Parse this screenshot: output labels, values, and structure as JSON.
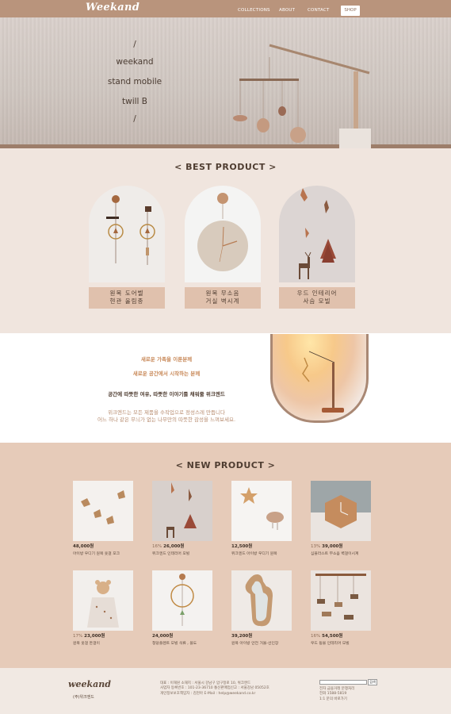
{
  "nav": {
    "logo": "Weekand",
    "menu": [
      "COLLECTIONS",
      "ABOUT",
      "CONTACT"
    ],
    "shop": "SHOP"
  },
  "hero": {
    "lines": [
      "/",
      "weekand",
      "stand mobile",
      "twill B",
      "/"
    ]
  },
  "best": {
    "title": "< BEST PRODUCT >",
    "cards": [
      {
        "line1": "원목 도어벨",
        "line2": "현관 울림종"
      },
      {
        "line1": "원목 무소음",
        "line2": "거실 벽시계"
      },
      {
        "line1": "우드 인테리어",
        "line2": "사슴 모빌"
      }
    ]
  },
  "story": {
    "line1": "새로운 가족을 이룬분께",
    "line2": "새로운 공간에서 시작하는 분께",
    "line3": "공간에 따뜻한 여유, 따뜻한 이야기를 채워줄 위크엔드",
    "line4": "위크엔드는 모든 제품을 수작업으로 정성스레 만듭니다",
    "line5": "어느 하나 같은 무늬가 없는 나무만의 따뜻한 감성을 느껴보세요."
  },
  "new": {
    "title": "< NEW PRODUCT >",
    "products": [
      {
        "pct": "",
        "price": "48,000원",
        "name": "아이방 우디기 원목 옷걸 포크"
      },
      {
        "pct": "16%",
        "price": "26,000원",
        "name": "위크엔드 인테리어 모빌"
      },
      {
        "pct": "",
        "price": "12,500원",
        "name": "위크엔드 아이방 우디기 원목"
      },
      {
        "pct": "13%",
        "price": "39,000원",
        "name": "심플라스트 무소음 벽걸이시계"
      },
      {
        "pct": "17%",
        "price": "23,000원",
        "name": "원목 옷걸 돈걸이"
      },
      {
        "pct": "",
        "price": "24,000원",
        "name": "청당플렌트 모빌 석류 , 블도"
      },
      {
        "pct": "",
        "price": "39,200원",
        "name": "원목 아이방 안전 거울-선인장"
      },
      {
        "pct": "16%",
        "price": "54,500원",
        "name": "우드 동물 인테리어 모빌"
      }
    ]
  },
  "footer": {
    "logo": "weekand",
    "corp": "(주)위크엔드",
    "info": [
      "대표 : 이해원 소재지 : 서울시 강남구 압구정로 10, 위크엔드",
      "사업자 등록번호 : 101-23-36710 통신판매업신고 : 서울강남 05052호",
      "개인정보보호책임자 : 김현아 E-Mail : help@weekand.co.kr"
    ],
    "search_btn": "검색",
    "contact": [
      "전자 금융거래 분쟁처리",
      "전화 1588-5819",
      "1:1 문의 바로가기"
    ]
  },
  "colors": {
    "nav": "#b9947c",
    "best_bg": "#f0e5de",
    "label_bg": "#e0c1ad",
    "new_bg": "#e6cbb9",
    "footer_bg": "#f1e9e3",
    "accent_orange": "#c98a5a"
  }
}
